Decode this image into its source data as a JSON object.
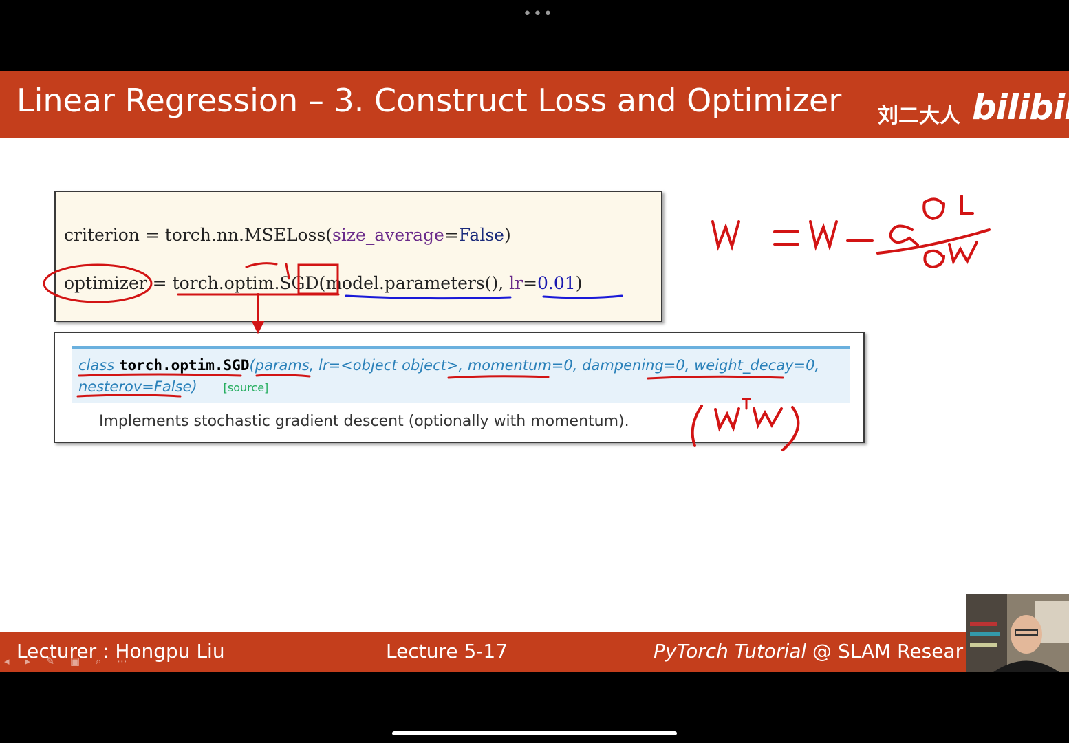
{
  "top_bar": {
    "dots": "•••"
  },
  "slide": {
    "title": "Linear Regression – 3. Construct Loss and Optimizer",
    "brand_cn": "刘二大人",
    "brand_logo": "bilibili",
    "code": {
      "line1": {
        "lhs": "criterion",
        "eq": " = ",
        "call": "torch.nn.MSELoss(",
        "arg": "size_average",
        "argeq": "=",
        "val": "False",
        "close": ")"
      },
      "line2": {
        "lhs": "optimizer",
        "eq": " = ",
        "call": "torch.optim.SGD(",
        "arg1": "model.parameters(), ",
        "arg2": "lr",
        "argeq": "=",
        "val": "0.01",
        "close": ")"
      }
    },
    "doc": {
      "cls": "class ",
      "name": "torch.optim.SGD",
      "sig1": "(params, lr=<object object>, momentum=0, dampening=0, weight_decay=0,",
      "sig2": "nesterov=False)",
      "source": "[source]",
      "description": "Implements stochastic gradient descent (optionally with momentum)."
    },
    "footer": {
      "lecturer": "Lecturer : Hongpu Liu",
      "lecture": "Lecture 5-17",
      "tutorial_italic": "PyTorch Tutorial",
      "tutorial_rest": " @ SLAM Resear"
    },
    "controls": "◂ ▸ ✎ ▣ ⌕ ⋯"
  },
  "colors": {
    "accent": "#c43e1c",
    "ink_red": "#d21414",
    "ink_blue": "#1a1ad8",
    "doc_blue": "#2980b9"
  }
}
